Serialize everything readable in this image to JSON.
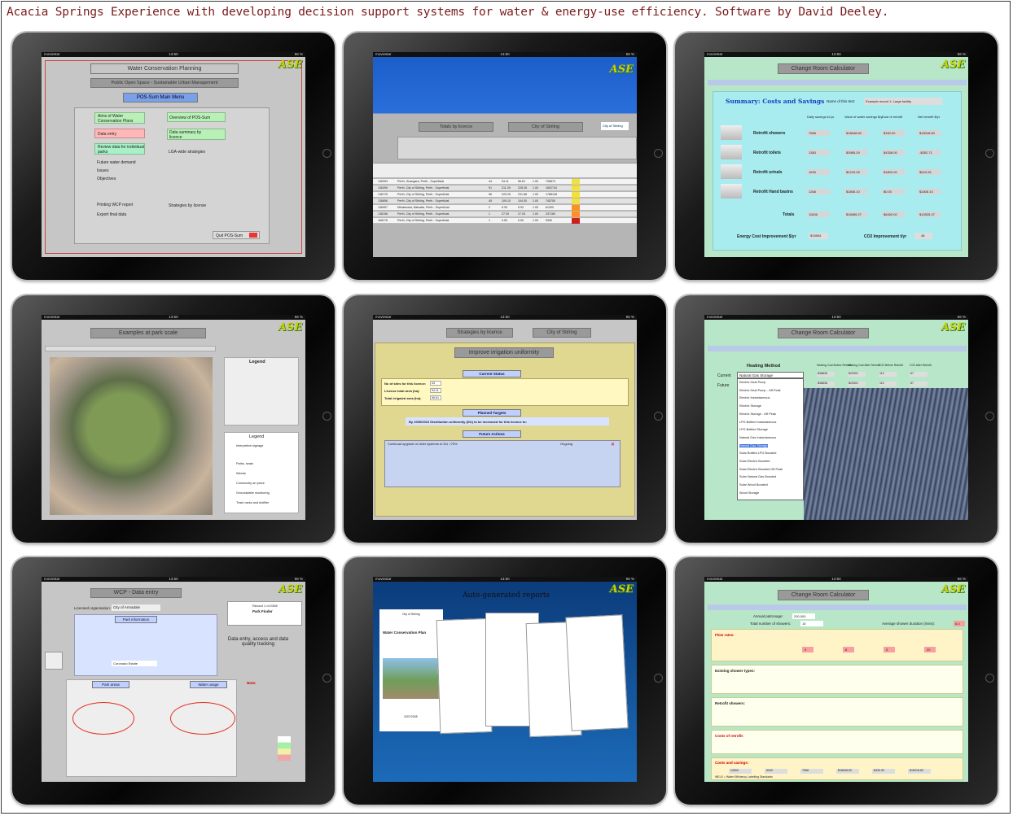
{
  "caption": "Acacia Springs Experience with developing decision support systems for water & energy-use efficiency. Software by David Deeley.",
  "statusbar": {
    "carrier": "moviestar",
    "time": "13:50",
    "battery": "56 %"
  },
  "logo": "ASE",
  "screens": {
    "s1": {
      "title": "Water Conservation Planning",
      "subtitle": "Public Open Space - Sustainable Urban Management",
      "main_menu": "POS-Sum Main Menu",
      "items": [
        "Aims of Water Conservation Plans",
        "Data entry",
        "Review data for individual parks",
        "Future water demand",
        "Issues",
        "Objectives",
        "Printing WCP report",
        "Export final data"
      ],
      "right_items": [
        "Overview of POS-Sum",
        "Data summary by licence",
        "LGA-wide strategies",
        "Strategies by license"
      ],
      "quit": "Quit POS-Sum"
    },
    "s2": {
      "tab1": "Totals by licence",
      "tab2": "City of Stirling",
      "logo": "City of Stirling",
      "rows": [
        [
          "136393",
          "Perth, Gnangara, Perth - Superficial",
          "44",
          "94.11",
          "96.61",
          "1.00",
          "708873"
        ],
        [
          "136395",
          "Perth, City of Stirling, Perth - Superficial",
          "91",
          "211.39",
          "228.28",
          "1.00",
          "1602744"
        ],
        [
          "136715",
          "Perth, City of Stirling, Perth - Superficial",
          "96",
          "220.25",
          "231.68",
          "1.00",
          "1788108"
        ],
        [
          "136856",
          "Perth, City of Stirling, Perth - Superficial",
          "45",
          "109.10",
          "104.00",
          "1.00",
          "745750"
        ],
        [
          "136957",
          "Mirrabooka, Balcatta, Perth - Superficial",
          "2",
          "5.93",
          "5.93",
          "1.00",
          "61200"
        ],
        [
          "138158",
          "Perth, City of Stirling, Perth - Superficial",
          "1",
          "27.30",
          "27.03",
          "1.00",
          "237180"
        ],
        [
          "168176",
          "Perth, City of Stirling, Perth - Superficial",
          "1",
          "0.50",
          "0.50",
          "1.00",
          "5300"
        ]
      ]
    },
    "s3": {
      "title": "Change Room Calculator",
      "heading": "Summary: Costs and Savings",
      "test_label": "Name of this test:",
      "test_value": "Example record 1: Large facility",
      "cols": [
        "Daily savings kL/yr",
        "Value of water savings $/yr",
        "Cost of retrofit",
        "Net benefit $/yr"
      ],
      "rows": [
        {
          "name": "Retrofit showers",
          "v": [
            "7568",
            "$18648.60",
            "$330.00",
            "$18318.60"
          ]
        },
        {
          "name": "Retrofit toilets",
          "v": [
            "1383",
            "$3985.29",
            "$4338.00",
            "-$352.71"
          ]
        },
        {
          "name": "Retrofit urinals",
          "v": [
            "1635",
            "$2243.28",
            "$1800.00",
            "$543.28"
          ]
        },
        {
          "name": "Retrofit Hand basins",
          "v": [
            "1268",
            "$1808.10",
            "$0.00",
            "$1808.10"
          ]
        }
      ],
      "totals": {
        "name": "Totals",
        "v": [
          "11836",
          "$16985.27",
          "$6450.00",
          "$10535.27"
        ]
      },
      "energy_label": "Energy Cost Improvement $/yr",
      "energy_value": "$15554",
      "co2_label": "CO2 Improvement t/yr",
      "co2_value": "48"
    },
    "s4": {
      "title": "Examples at park scale",
      "legend_title": "Legend",
      "legend_items": [
        "Interpretive signage",
        "Paths, seats",
        "Weeds",
        "Community art piece",
        "Groundwater monitoring",
        "Trash racks and biofilter"
      ]
    },
    "s5": {
      "title": "Strategies by licence",
      "org": "City of Stirling",
      "heading": "Improve irrigation uniformity",
      "current_status": "Current Status",
      "status_rows": [
        {
          "label": "No of sites for this licence:",
          "value": "44"
        },
        {
          "label": "License total area (ha):",
          "value": "94.11"
        },
        {
          "label": "Total irrigated area (ha):",
          "value": "96.61"
        }
      ],
      "planned_targets": "Planned Targets",
      "target_text": "By 2009/2010  Distribution uniformity (DU) to be increased for this licence to:",
      "future_actions": "Future Actions",
      "action_text": "Continual upgrade of older systems to DU >75%",
      "time_text": "Ongoing"
    },
    "s6": {
      "title": "Change Room Calculator",
      "heading": "Heating Method",
      "current_label": "Current",
      "future_label": "Future",
      "current_value": "Natural Gas Storage",
      "options": [
        "Electric Heat Pump",
        "Electric Heat Pump - Off Peak",
        "Electric Instantaneous",
        "Electric Storage",
        "Electric Storage - Off Peak",
        "LPG Bottled Instantaneous",
        "LPG Bottled Storage",
        "Natural Gas Instantaneous",
        "Natural Gas Storage",
        "Solar Bottled LPG Boosted",
        "Solar Electric Boosted",
        "Solar Electric Boosted Off Peak",
        "Solar Natural Gas Boosted",
        "Solar Wood Boosted",
        "Wood Storage"
      ],
      "cols": [
        "Heating Cost Before Retrofit",
        "Heating Cost After Retrofit",
        "CO2 Before Retrofit",
        "CO2 After Retrofit"
      ],
      "current_vals": [
        "$38836",
        "$23301",
        "112",
        "67"
      ],
      "future_vals": [
        "$38836",
        "$23301",
        "112",
        "67"
      ]
    },
    "s7": {
      "title": "WCP - Data entry",
      "org_label": "Licensed organisation:",
      "org_value": "City of Armadale",
      "record_label": "Record 1 of 2306",
      "finder": "Park Finder",
      "park_info": "Park information",
      "park_name": "Coronado Estate",
      "annotation": "Data entry, access and data quality tracking",
      "park_areas": "Park areas",
      "water_usage": "Water usage",
      "note": "Note:"
    },
    "s8": {
      "title": "Auto-generated reports",
      "report_title": "Water Conservation Plan",
      "org": "City of Stirling",
      "year": "2007/2008"
    },
    "s9": {
      "title": "Change Room Calculator",
      "patronage_label": "Annual patronage:",
      "patronage_value": "200,000",
      "showers_label": "Total number of showers:",
      "showers_value": "15",
      "avg_label": "Average shower duration (mins):",
      "avg_value": "6.0",
      "flow_rates": "Flow rates:",
      "flow_vals": [
        "9",
        "8",
        "5",
        "20"
      ],
      "existing": "Existing shower types:",
      "retrofit": "Retrofit showers:",
      "costs_retrofit": "Costs of retrofit:",
      "costs_savings": "Costs and savings:",
      "savings_vals": [
        "12600",
        "5040",
        "7568",
        "$18648.60",
        "$330.00",
        "$18318.60"
      ],
      "wels": "WELS = Water Efficiency Labelling Standards"
    }
  }
}
